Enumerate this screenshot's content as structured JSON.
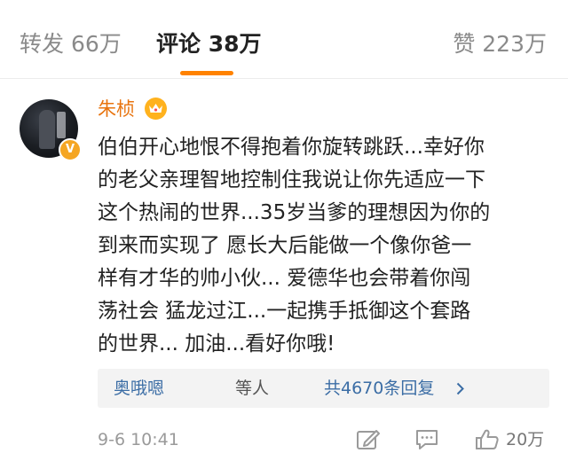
{
  "tabs": {
    "repost": "转发 66万",
    "comment": "评论 38万",
    "like": "赞 223万",
    "active_color": "#ff8200"
  },
  "comment": {
    "username": "朱桢",
    "username_color": "#e8740f",
    "badge_icon": "crown-icon",
    "verified_icon": "verified-badge-icon",
    "text_lines": [
      "伯伯开心地恨不得抱着你旋转跳跃...幸好你",
      "的老父亲理智地控制住我说让你先适应一下",
      "这个热闹的世界...35岁当爹的理想因为你的",
      "到来而实现了 愿长大后能做一个像你爸一",
      "样有才华的帅小伙... 爱德华也会带着你闯",
      "荡社会 猛龙过江...一起携手抵御这个套路",
      "的世界... 加油...看好你哦!"
    ],
    "replies": {
      "names": "奥哦嗯",
      "suffix": "等人",
      "count": "共4670条回复",
      "link_color": "#3b6da5"
    },
    "timestamp": "9-6 10:41",
    "like_count": "20万"
  }
}
